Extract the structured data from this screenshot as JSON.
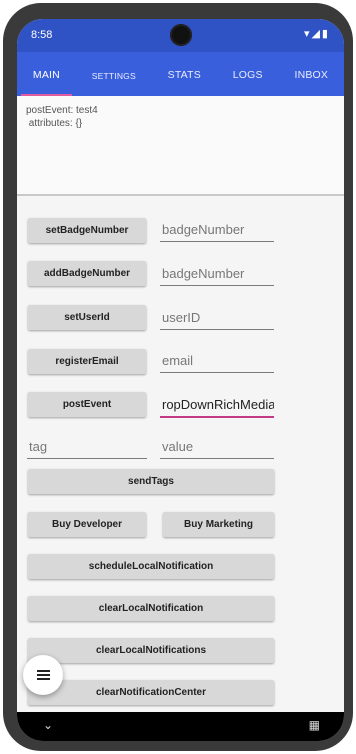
{
  "status": {
    "time": "8:58",
    "icons_text": "▾◢▮"
  },
  "tabs": [
    {
      "label": "MAIN"
    },
    {
      "label": "SETTINGS"
    },
    {
      "label": "STATS"
    },
    {
      "label": "LOGS"
    },
    {
      "label": "INBOX"
    }
  ],
  "log": {
    "text": "postEvent: test4\n attributes: {}"
  },
  "buttons": {
    "setBadgeNumber": "setBadgeNumber",
    "addBadgeNumber": "addBadgeNumber",
    "setUserId": "setUserId",
    "registerEmail": "registerEmail",
    "postEvent": "postEvent",
    "sendTags": "sendTags",
    "buyDeveloper": "Buy Developer",
    "buyMarketing": "Buy Marketing",
    "scheduleLocal": "scheduleLocalNotification",
    "clearLocal": "clearLocalNotification",
    "clearLocals": "clearLocalNotifications",
    "partial": "clearNotificationCenter"
  },
  "fields": {
    "badge1_placeholder": "badgeNumber",
    "badge2_placeholder": "badgeNumber",
    "userid_placeholder": "userID",
    "email_placeholder": "email",
    "event_value": "ropDownRichMedia",
    "tag_placeholder": "tag",
    "value_placeholder": "value"
  },
  "nav": {
    "back": "⌄",
    "keyboard": "▦"
  },
  "colors": {
    "statusbar": "#2f52c4",
    "tabbar": "#3a5fdc",
    "accent": "#e05aa0"
  }
}
